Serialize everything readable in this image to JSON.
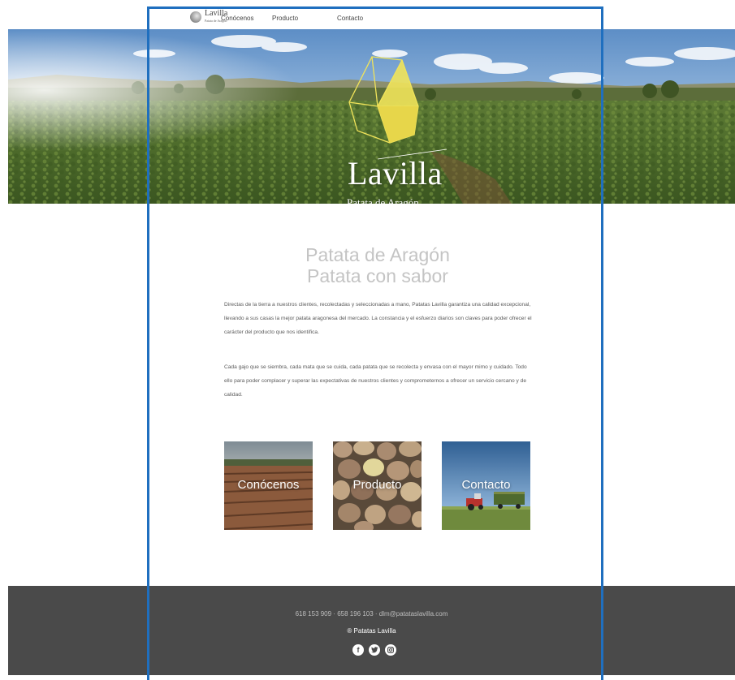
{
  "nav": {
    "logo_text": "Lavilla",
    "logo_sub": "Patata de Aragón",
    "links": [
      "Conócenos",
      "Producto",
      "Contacto"
    ]
  },
  "hero": {
    "title": "Lavilla",
    "subtitle": "Patata de Aragón"
  },
  "headline": {
    "line1": "Patata de Aragón",
    "line2": "Patata con sabor"
  },
  "paragraphs": [
    "Directas de la tierra a nuestros clientes, recolectadas y seleccionadas a mano, Patatas Lavilla garantiza una calidad excepcional, llevando a sus casas la mejor patata aragonesa del mercado. La constancia y el esfuerzo diarios son claves para poder ofrecer el carácter del producto que nos identifica.",
    "Cada gajo que se siembra, cada mata que se cuida, cada patata que se recolecta y envasa con el mayor mimo y cuidado. Todo ello para poder complacer y superar las expectativas de nuestros clientes y comprometernos a ofrecer un servicio cercano y de calidad."
  ],
  "tiles": [
    "Conócenos",
    "Producto",
    "Contacto"
  ],
  "footer": {
    "contact": "618 153 909  ·  658 196 103  ·  dlm@patataslavilla.com",
    "brand": "® Patatas Lavilla",
    "social_icons": [
      "facebook-icon",
      "twitter-icon",
      "instagram-icon"
    ]
  },
  "colors": {
    "accent_yellow": "#f0e35a",
    "footer_bg": "#4a4a4a",
    "guide_blue": "#1f6fbf"
  }
}
